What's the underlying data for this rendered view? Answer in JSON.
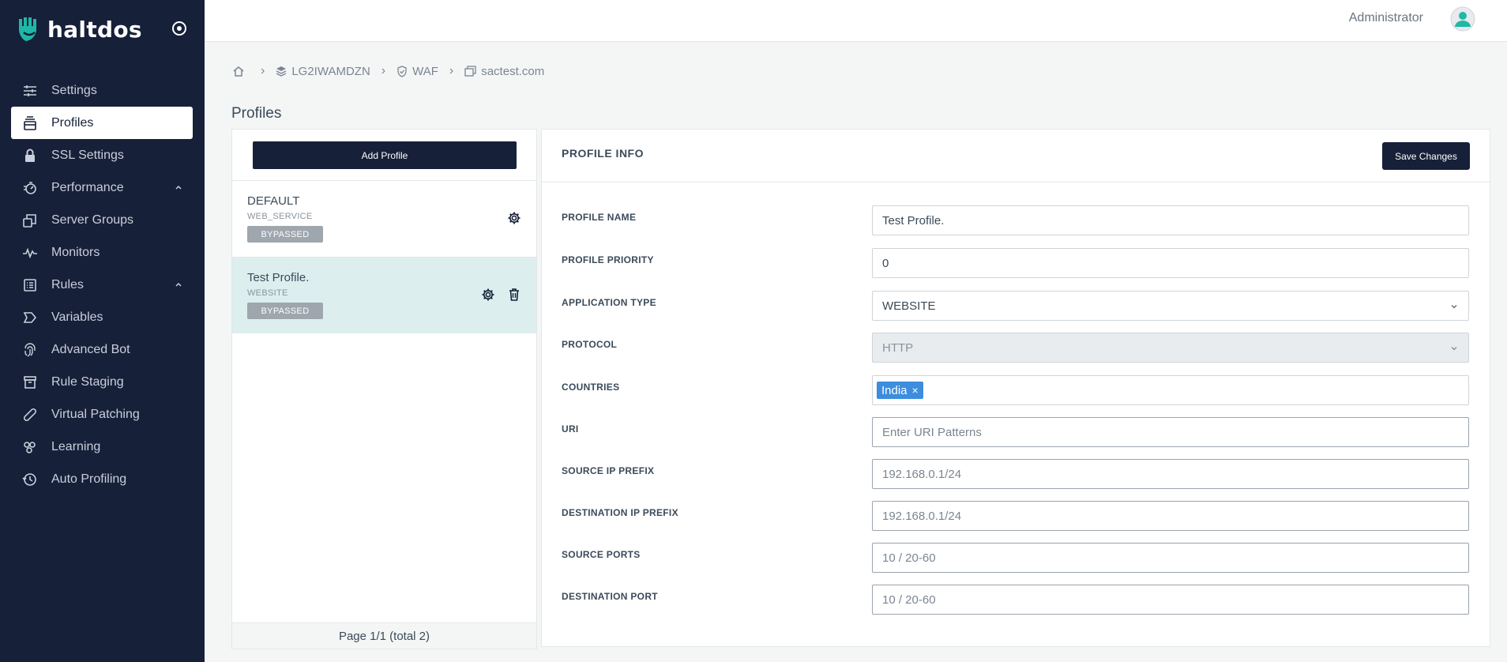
{
  "brand": {
    "name": "haltdos"
  },
  "header": {
    "user_name": "Administrator"
  },
  "sidebar": {
    "items": [
      {
        "label": "Settings",
        "icon": "sliders-icon"
      },
      {
        "label": "Profiles",
        "icon": "profiles-icon",
        "active": true
      },
      {
        "label": "SSL Settings",
        "icon": "lock-icon"
      },
      {
        "label": "Performance",
        "icon": "performance-icon",
        "expandable": true
      },
      {
        "label": "Server Groups",
        "icon": "server-groups-icon"
      },
      {
        "label": "Monitors",
        "icon": "pulse-icon"
      },
      {
        "label": "Rules",
        "icon": "rules-icon",
        "expandable": true
      },
      {
        "label": "Variables",
        "icon": "tag-icon"
      },
      {
        "label": "Advanced Bot",
        "icon": "fingerprint-icon"
      },
      {
        "label": "Rule Staging",
        "icon": "archive-icon"
      },
      {
        "label": "Virtual Patching",
        "icon": "bandage-icon"
      },
      {
        "label": "Learning",
        "icon": "learning-icon"
      },
      {
        "label": "Auto Profiling",
        "icon": "history-icon"
      }
    ]
  },
  "breadcrumb": {
    "items": [
      {
        "label": "LG2IWAMDZN",
        "icon": "layers-icon"
      },
      {
        "label": "WAF",
        "icon": "shield-icon"
      },
      {
        "label": "sactest.com",
        "icon": "window-icon"
      }
    ]
  },
  "page": {
    "title": "Profiles"
  },
  "profiles_panel": {
    "add_label": "Add Profile",
    "profiles": [
      {
        "name": "DEFAULT",
        "type": "WEB_SERVICE",
        "status": "BYPASSED"
      },
      {
        "name": "Test Profile.",
        "type": "WEBSITE",
        "status": "BYPASSED"
      }
    ],
    "pager": "Page 1/1 (total 2)"
  },
  "profile_info": {
    "title": "PROFILE INFO",
    "save_label": "Save Changes",
    "fields": {
      "name": {
        "label": "PROFILE NAME",
        "value": "Test Profile."
      },
      "priority": {
        "label": "PROFILE PRIORITY",
        "value": "0"
      },
      "app_type": {
        "label": "APPLICATION TYPE",
        "value": "WEBSITE"
      },
      "protocol": {
        "label": "PROTOCOL",
        "value": "HTTP"
      },
      "countries": {
        "label": "COUNTRIES",
        "tags": [
          "India"
        ]
      },
      "uri": {
        "label": "URI",
        "placeholder": "Enter URI Patterns"
      },
      "src_ip": {
        "label": "SOURCE IP PREFIX",
        "placeholder": "192.168.0.1/24"
      },
      "dst_ip": {
        "label": "DESTINATION IP PREFIX",
        "placeholder": "192.168.0.1/24"
      },
      "src_ports": {
        "label": "SOURCE PORTS",
        "placeholder": "10 / 20-60"
      },
      "dst_port": {
        "label": "DESTINATION PORT",
        "placeholder": "10 / 20-60"
      }
    }
  },
  "colors": {
    "sidebar_bg": "#172039",
    "brand_accent": "#1fb8a6",
    "selected_row": "#dcefee",
    "tag_blue": "#3c8dde",
    "badge_gray": "#9ea6ae"
  }
}
